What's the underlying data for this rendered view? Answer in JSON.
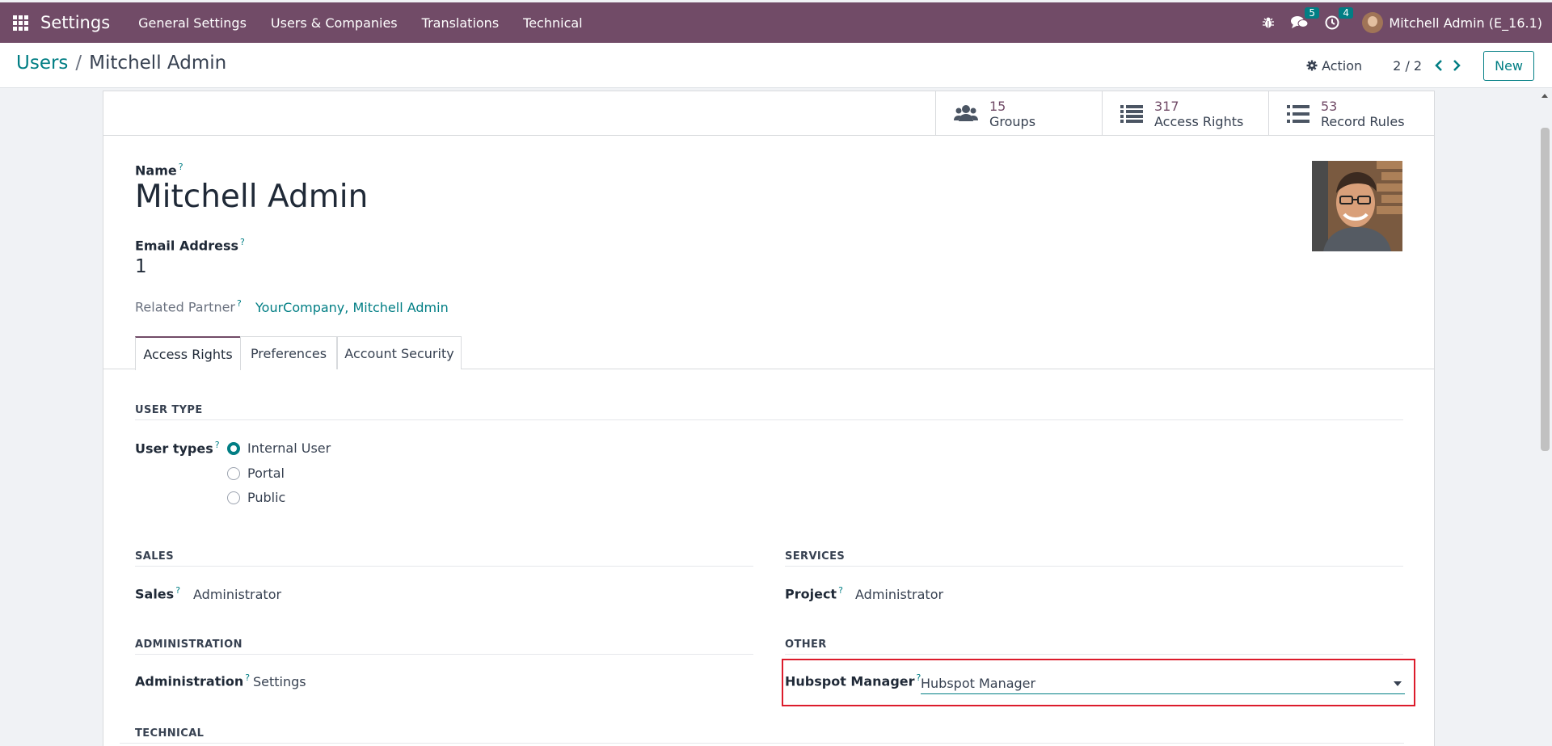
{
  "navbar": {
    "app_title": "Settings",
    "menu": [
      "General Settings",
      "Users & Companies",
      "Translations",
      "Technical"
    ],
    "messages_count": "5",
    "activities_count": "4",
    "user_label": "Mitchell Admin (E_16.1)"
  },
  "control": {
    "breadcrumb_parent": "Users",
    "breadcrumb_sep": "/",
    "breadcrumb_current": "Mitchell Admin",
    "action_label": "Action",
    "pager": "2 / 2",
    "new_label": "New"
  },
  "stats": [
    {
      "value": "15",
      "label": "Groups",
      "icon": "users-icon"
    },
    {
      "value": "317",
      "label": "Access Rights",
      "icon": "list-icon"
    },
    {
      "value": "53",
      "label": "Record Rules",
      "icon": "list-icon"
    }
  ],
  "form": {
    "name_label": "Name",
    "name_value": "Mitchell Admin",
    "email_label": "Email Address",
    "email_value": "1",
    "partner_label": "Related Partner",
    "partner_value": "YourCompany, Mitchell Admin",
    "help_mark": "?"
  },
  "tabs": [
    "Access Rights",
    "Preferences",
    "Account Security"
  ],
  "access": {
    "user_type_title": "USER TYPE",
    "user_types_label": "User types",
    "user_types": [
      "Internal User",
      "Portal",
      "Public"
    ],
    "selected_user_type": "Internal User",
    "sales_title": "SALES",
    "sales_label": "Sales",
    "sales_value": "Administrator",
    "services_title": "SERVICES",
    "project_label": "Project",
    "project_value": "Administrator",
    "administration_title": "ADMINISTRATION",
    "administration_label": "Administration",
    "administration_value": "Settings",
    "other_title": "OTHER",
    "hubspot_label": "Hubspot Manager",
    "hubspot_value": "Hubspot Manager",
    "technical_title": "TECHNICAL"
  },
  "colors": {
    "navbar": "#714b67",
    "accent": "#017e84",
    "highlight": "#dc1b2b"
  }
}
